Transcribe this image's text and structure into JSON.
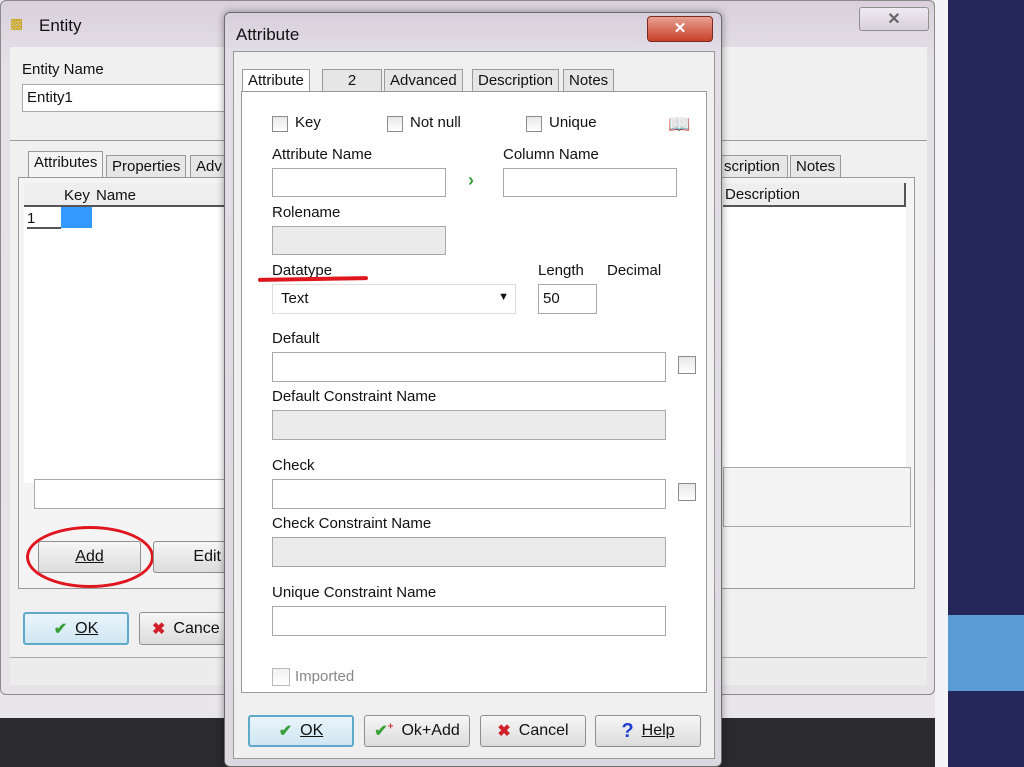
{
  "entity_window": {
    "title": "Entity",
    "entity_name_label": "Entity Name",
    "entity_name_value": "Entity1",
    "tabs": [
      "Attributes",
      "Properties",
      "Adv",
      "scription",
      "Notes"
    ],
    "grid_headers": [
      "Key",
      "Name",
      "Description"
    ],
    "grid_rows": [
      {
        "num": "1"
      }
    ],
    "add_button": "Add",
    "edit_button": "Edit",
    "ok_button": "OK",
    "cancel_button": "Cance"
  },
  "attribute_dialog": {
    "title": "Attribute",
    "tabs": [
      "Attribute",
      "2",
      "Advanced",
      "Description",
      "Notes"
    ],
    "active_tab": "Attribute",
    "checkboxes": {
      "key": "Key",
      "not_null": "Not null",
      "unique": "Unique",
      "imported": "Imported"
    },
    "attribute_name_label": "Attribute Name",
    "attribute_name_value": "",
    "column_name_label": "Column Name",
    "column_name_value": "",
    "rolename_label": "Rolename",
    "datatype_label": "Datatype",
    "datatype_value": "Text",
    "length_label": "Length",
    "length_value": "50",
    "decimal_label": "Decimal",
    "default_label": "Default",
    "default_constraint_label": "Default Constraint Name",
    "check_label": "Check",
    "check_constraint_label": "Check Constraint Name",
    "unique_constraint_label": "Unique Constraint Name",
    "buttons": {
      "ok": "OK",
      "ok_add": "Ok+Add",
      "cancel": "Cancel",
      "help": "Help"
    }
  },
  "colors": {
    "annotation_red": "#e0161e",
    "selection_blue": "#3399ff",
    "navy": "#25275a",
    "light_blue": "#5b9bd5"
  }
}
